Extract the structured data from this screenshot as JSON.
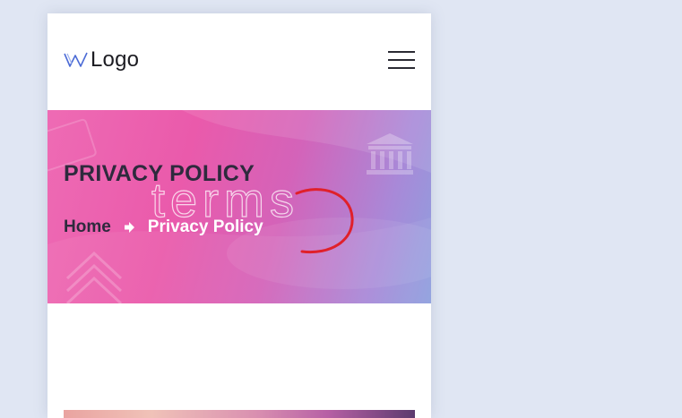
{
  "header": {
    "logo_text": "Logo",
    "logo_icon": "w-logo-icon",
    "menu_icon": "hamburger-menu-icon"
  },
  "banner": {
    "title": "PRIVACY POLICY",
    "watermark": "terms",
    "breadcrumb": {
      "home": "Home",
      "separator_icon": "arrow-right-icon",
      "current": "Privacy Policy"
    }
  },
  "colors": {
    "page_background": "#e0e6f3",
    "banner_gradient_start": "#ee6bb4",
    "banner_gradient_end": "#8ea0de",
    "title_text": "#2e2a3d",
    "scribble": "#e0202a"
  }
}
